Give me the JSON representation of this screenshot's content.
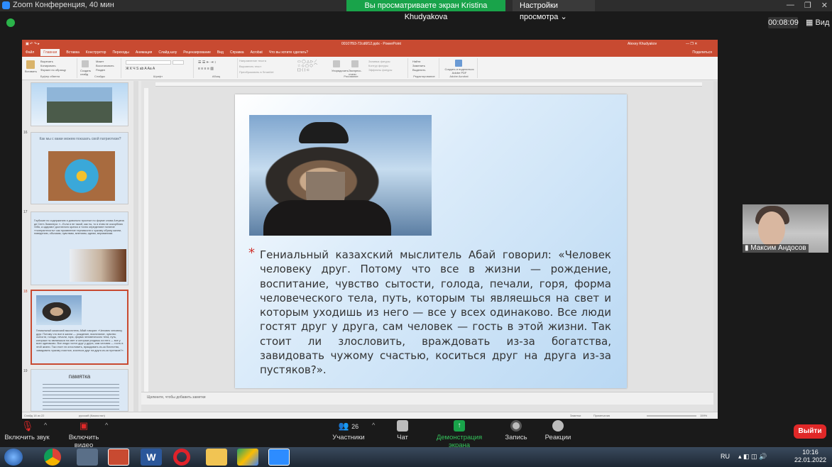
{
  "zoom": {
    "window_title": "Zoom Конференция, 40 мин",
    "share_banner": "Вы просматриваете экран Kristina Khudyakova",
    "view_settings": "Настройки просмотра",
    "timer": "00:08:09",
    "view_label": "Вид",
    "participant_name": "Максим Андосов",
    "toolbar": {
      "mute": "Включить звук",
      "video": "Включить видео",
      "participants_count": "26",
      "participants": "Участники",
      "chat": "Чат",
      "share": "Демонстрация экрана",
      "record": "Запись",
      "reactions": "Реакции",
      "leave": "Выйти"
    },
    "colors": {
      "share_green": "#19a34a",
      "leave_red": "#e02828",
      "ppt_accent": "#c84a31"
    }
  },
  "powerpoint": {
    "title": "00107f93-72cd6f12.pptx - PowerPoint",
    "user": "Alexey Khudyakov",
    "share_label": "Поделиться",
    "tabs": [
      "Файл",
      "Главная",
      "Вставка",
      "Конструктор",
      "Переходы",
      "Анимация",
      "Слайд-шоу",
      "Рецензирование",
      "Вид",
      "Справка",
      "Acrobat",
      "Что вы хотите сделать?"
    ],
    "active_tab": "Главная",
    "ribbon": {
      "paste": "Вставить",
      "cut": "Вырезать",
      "copy": "Копировать",
      "format_painter": "Формат по образцу",
      "clipboard": "Буфер обмена",
      "new_slide": "Создать слайд",
      "layout": "Макет",
      "reset": "Восстановить",
      "section": "Раздел",
      "slides": "Слайды",
      "font": "Шрифт",
      "paragraph": "Абзац",
      "text_direction": "Направление текста",
      "align_text": "Выровнять текст",
      "smartart": "Преобразовать в SmartArt",
      "arrange": "Упорядочить",
      "quick_styles": "Экспресс-стили",
      "shape_fill": "Заливка фигуры",
      "shape_outline": "Контур фигуры",
      "shape_effects": "Эффекты фигуры",
      "drawing": "Рисование",
      "find": "Найти",
      "replace": "Заменить",
      "select": "Выделить",
      "editing": "Редактирование",
      "create_share": "Создать и поделиться Adobe PDF",
      "adobe": "Adobe Acrobat"
    },
    "thumbnails": [
      {
        "num": "",
        "title": ""
      },
      {
        "num": "16",
        "title": "Как мы с вами можем показать свой патриотизм?"
      },
      {
        "num": "17",
        "title": "Глубокие по содержанию и довольно простые по форме слова Антуана де Сент-Экзюпери: «...Если я не такой, как ты, то я этим не оскорбляю тебя, а одаряю» достаточно кратко и точно определяют понятие «толерантность» как проявление терпимости к чужому образу жизни, поведению, обычаям, чувствам, мнениям, идеям, верованиям."
      },
      {
        "num": "18",
        "title": "Гениальный казахский мыслитель Абай говорил: «Человек человеку друг. Потому что все в жизни — рождение, воспитание, чувство сытости, голода, печали, горя, форма человеческого тела, путь, которым ты являешься на свет и которым уходишь из него — все у всех одинаково. Все люди гостят друг у друга, сам человек — гость в этой жизни. Так стоит ли злословить, враждовать из-за богатства, завидовать чужому счастью, коситься друг на друга из-за пустяков?»."
      },
      {
        "num": "19",
        "title": "памятка"
      }
    ],
    "slide_text": "Гениальный казахский мыслитель Абай говорил: «Человек человеку друг. Потому что все в жизни — рождение, воспитание, чувство сытости, голода, печали, горя, форма человеческого тела, путь, которым ты являешься на свет и которым уходишь из него — все у всех одинаково. Все люди гостят друг у друга, сам человек — гость в этой жизни. Так стоит ли злословить, враждовать из-за богатства, завидовать чужому счастью, коситься друг на друга из-за пустяков?».",
    "notes_placeholder": "Щелкните, чтобы добавить заметки",
    "status": {
      "slide": "Слайд 18 из 22",
      "language": "русский (Казахстан)",
      "notes": "Заметки",
      "comments": "Примечания",
      "zoom": "159%"
    }
  },
  "taskbar": {
    "lang": "RU",
    "time": "10:16",
    "date": "22.01.2022"
  }
}
